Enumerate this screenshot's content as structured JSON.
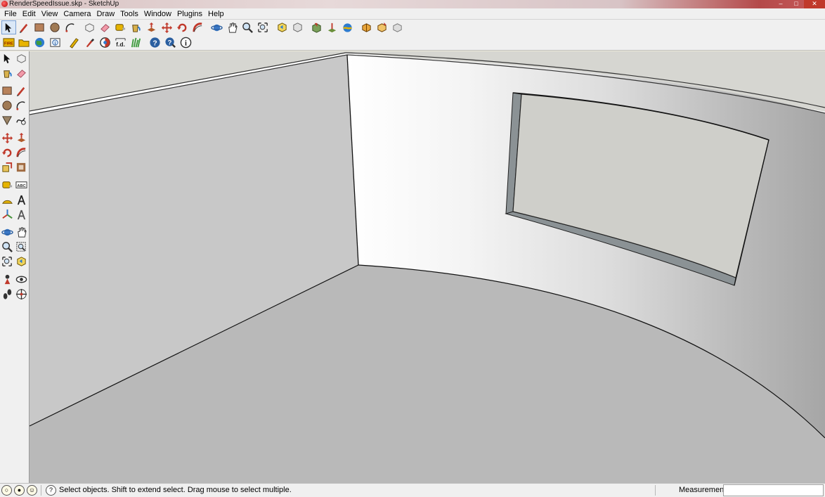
{
  "window": {
    "title": "RenderSpeedIssue.skp - SketchUp"
  },
  "menu": [
    "File",
    "Edit",
    "View",
    "Camera",
    "Draw",
    "Tools",
    "Window",
    "Plugins",
    "Help"
  ],
  "toolbar1": [
    "select-icon",
    "pencil-icon",
    "rectangle-icon",
    "circle-icon",
    "arc-icon",
    "sep",
    "make-component-icon",
    "eraser-icon",
    "tape-measure-icon",
    "paint-bucket-icon",
    "push-pull-icon",
    "move-icon",
    "rotate-icon",
    "follow-me-icon",
    "sep",
    "orbit-icon",
    "pan-icon",
    "zoom-icon",
    "zoom-extents-icon",
    "sep",
    "previous-view-icon",
    "next-view-icon",
    "sep",
    "photo-texture-icon",
    "add-location-icon",
    "toggle-terrain-icon",
    "sep",
    "get-models-icon",
    "share-model-icon",
    "share-component-icon"
  ],
  "toolbar2": [
    "fire-plugin-icon",
    "folder-icon",
    "globe-icon",
    "model-info-icon",
    "sep",
    "measure-pencil-icon",
    "dropper-icon",
    "section-icon",
    "fd-label-icon",
    "grass-icon",
    "sep",
    "help-icon",
    "help-search-icon",
    "info-icon"
  ],
  "left_toolbar": [
    [
      "select-icon",
      "make-component-icon"
    ],
    [
      "paint-bucket-icon",
      "eraser-icon"
    ],
    [
      "gap"
    ],
    [
      "rectangle-icon",
      "line-icon"
    ],
    [
      "circle-icon",
      "arc-icon"
    ],
    [
      "polygon-icon",
      "freehand-icon"
    ],
    [
      "gap"
    ],
    [
      "move-icon",
      "push-pull-icon"
    ],
    [
      "rotate-icon",
      "follow-me-icon"
    ],
    [
      "scale-icon",
      "offset-icon"
    ],
    [
      "gap"
    ],
    [
      "tape-measure-icon",
      "dimension-icon"
    ],
    [
      "protractor-icon",
      "text-icon"
    ],
    [
      "axes-icon",
      "3d-text-icon"
    ],
    [
      "gap"
    ],
    [
      "orbit-icon",
      "pan-icon"
    ],
    [
      "zoom-icon",
      "zoom-window-icon"
    ],
    [
      "zoom-extents-icon",
      "previous-view-icon"
    ],
    [
      "gap"
    ],
    [
      "position-camera-icon",
      "look-around-icon"
    ],
    [
      "walk-icon",
      "section-plane-icon"
    ]
  ],
  "status": {
    "hint": "Select objects. Shift to extend select. Drag mouse to select multiple.",
    "measurements_label": "Measurements",
    "measurements_value": ""
  },
  "colors": {
    "chrome": "#f0f0f0",
    "wall_left": "#c6c6c6",
    "floor": "#b9b9b9",
    "ceiling": "#d6d6d1",
    "window_glass": "#cfcfca",
    "window_reveal": "#8b9295",
    "accent_red": "#c0392b"
  }
}
